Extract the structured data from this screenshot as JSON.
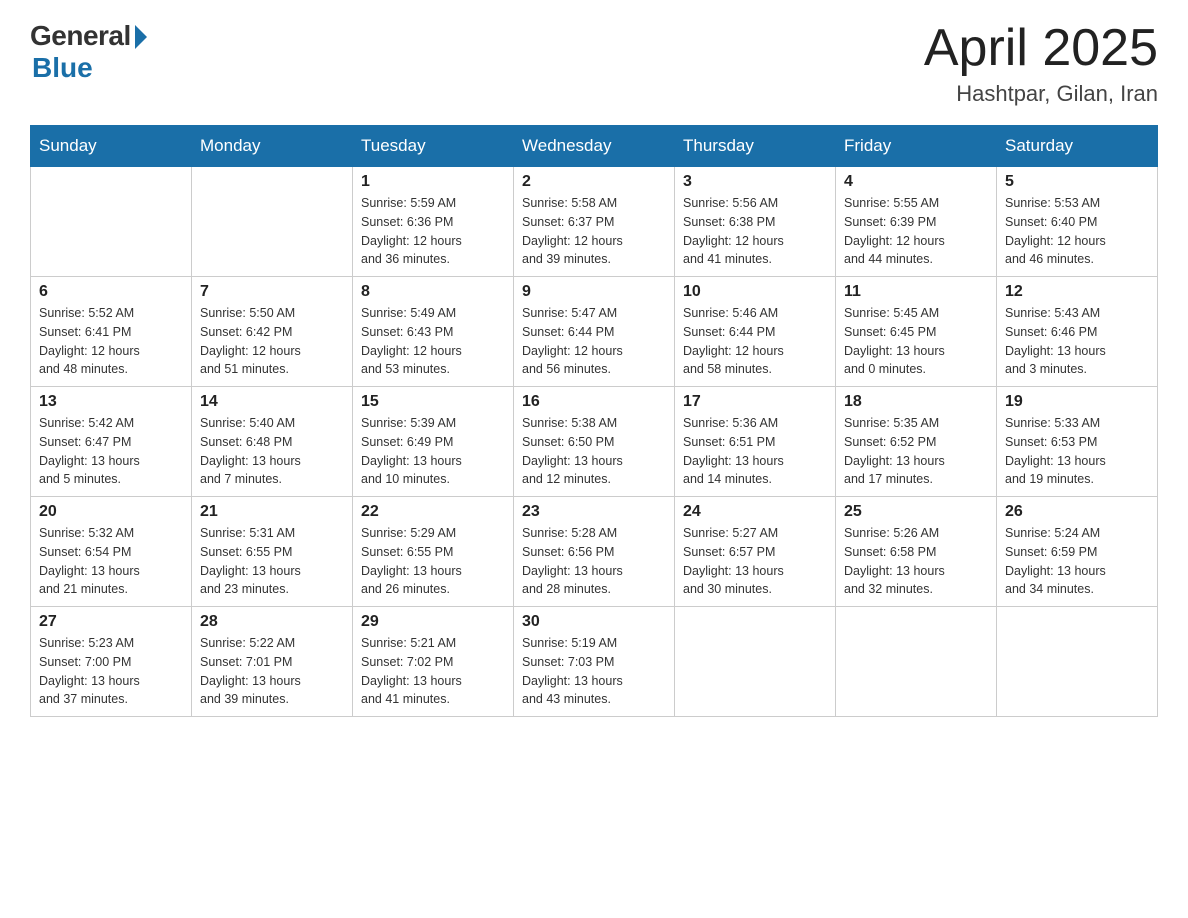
{
  "header": {
    "logo_general": "General",
    "logo_blue": "Blue",
    "logo_subtitle": "Blue",
    "calendar_title": "April 2025",
    "location": "Hashtpar, Gilan, Iran"
  },
  "days_of_week": [
    "Sunday",
    "Monday",
    "Tuesday",
    "Wednesday",
    "Thursday",
    "Friday",
    "Saturday"
  ],
  "weeks": [
    [
      {
        "day": "",
        "info": ""
      },
      {
        "day": "",
        "info": ""
      },
      {
        "day": "1",
        "info": "Sunrise: 5:59 AM\nSunset: 6:36 PM\nDaylight: 12 hours\nand 36 minutes."
      },
      {
        "day": "2",
        "info": "Sunrise: 5:58 AM\nSunset: 6:37 PM\nDaylight: 12 hours\nand 39 minutes."
      },
      {
        "day": "3",
        "info": "Sunrise: 5:56 AM\nSunset: 6:38 PM\nDaylight: 12 hours\nand 41 minutes."
      },
      {
        "day": "4",
        "info": "Sunrise: 5:55 AM\nSunset: 6:39 PM\nDaylight: 12 hours\nand 44 minutes."
      },
      {
        "day": "5",
        "info": "Sunrise: 5:53 AM\nSunset: 6:40 PM\nDaylight: 12 hours\nand 46 minutes."
      }
    ],
    [
      {
        "day": "6",
        "info": "Sunrise: 5:52 AM\nSunset: 6:41 PM\nDaylight: 12 hours\nand 48 minutes."
      },
      {
        "day": "7",
        "info": "Sunrise: 5:50 AM\nSunset: 6:42 PM\nDaylight: 12 hours\nand 51 minutes."
      },
      {
        "day": "8",
        "info": "Sunrise: 5:49 AM\nSunset: 6:43 PM\nDaylight: 12 hours\nand 53 minutes."
      },
      {
        "day": "9",
        "info": "Sunrise: 5:47 AM\nSunset: 6:44 PM\nDaylight: 12 hours\nand 56 minutes."
      },
      {
        "day": "10",
        "info": "Sunrise: 5:46 AM\nSunset: 6:44 PM\nDaylight: 12 hours\nand 58 minutes."
      },
      {
        "day": "11",
        "info": "Sunrise: 5:45 AM\nSunset: 6:45 PM\nDaylight: 13 hours\nand 0 minutes."
      },
      {
        "day": "12",
        "info": "Sunrise: 5:43 AM\nSunset: 6:46 PM\nDaylight: 13 hours\nand 3 minutes."
      }
    ],
    [
      {
        "day": "13",
        "info": "Sunrise: 5:42 AM\nSunset: 6:47 PM\nDaylight: 13 hours\nand 5 minutes."
      },
      {
        "day": "14",
        "info": "Sunrise: 5:40 AM\nSunset: 6:48 PM\nDaylight: 13 hours\nand 7 minutes."
      },
      {
        "day": "15",
        "info": "Sunrise: 5:39 AM\nSunset: 6:49 PM\nDaylight: 13 hours\nand 10 minutes."
      },
      {
        "day": "16",
        "info": "Sunrise: 5:38 AM\nSunset: 6:50 PM\nDaylight: 13 hours\nand 12 minutes."
      },
      {
        "day": "17",
        "info": "Sunrise: 5:36 AM\nSunset: 6:51 PM\nDaylight: 13 hours\nand 14 minutes."
      },
      {
        "day": "18",
        "info": "Sunrise: 5:35 AM\nSunset: 6:52 PM\nDaylight: 13 hours\nand 17 minutes."
      },
      {
        "day": "19",
        "info": "Sunrise: 5:33 AM\nSunset: 6:53 PM\nDaylight: 13 hours\nand 19 minutes."
      }
    ],
    [
      {
        "day": "20",
        "info": "Sunrise: 5:32 AM\nSunset: 6:54 PM\nDaylight: 13 hours\nand 21 minutes."
      },
      {
        "day": "21",
        "info": "Sunrise: 5:31 AM\nSunset: 6:55 PM\nDaylight: 13 hours\nand 23 minutes."
      },
      {
        "day": "22",
        "info": "Sunrise: 5:29 AM\nSunset: 6:55 PM\nDaylight: 13 hours\nand 26 minutes."
      },
      {
        "day": "23",
        "info": "Sunrise: 5:28 AM\nSunset: 6:56 PM\nDaylight: 13 hours\nand 28 minutes."
      },
      {
        "day": "24",
        "info": "Sunrise: 5:27 AM\nSunset: 6:57 PM\nDaylight: 13 hours\nand 30 minutes."
      },
      {
        "day": "25",
        "info": "Sunrise: 5:26 AM\nSunset: 6:58 PM\nDaylight: 13 hours\nand 32 minutes."
      },
      {
        "day": "26",
        "info": "Sunrise: 5:24 AM\nSunset: 6:59 PM\nDaylight: 13 hours\nand 34 minutes."
      }
    ],
    [
      {
        "day": "27",
        "info": "Sunrise: 5:23 AM\nSunset: 7:00 PM\nDaylight: 13 hours\nand 37 minutes."
      },
      {
        "day": "28",
        "info": "Sunrise: 5:22 AM\nSunset: 7:01 PM\nDaylight: 13 hours\nand 39 minutes."
      },
      {
        "day": "29",
        "info": "Sunrise: 5:21 AM\nSunset: 7:02 PM\nDaylight: 13 hours\nand 41 minutes."
      },
      {
        "day": "30",
        "info": "Sunrise: 5:19 AM\nSunset: 7:03 PM\nDaylight: 13 hours\nand 43 minutes."
      },
      {
        "day": "",
        "info": ""
      },
      {
        "day": "",
        "info": ""
      },
      {
        "day": "",
        "info": ""
      }
    ]
  ]
}
